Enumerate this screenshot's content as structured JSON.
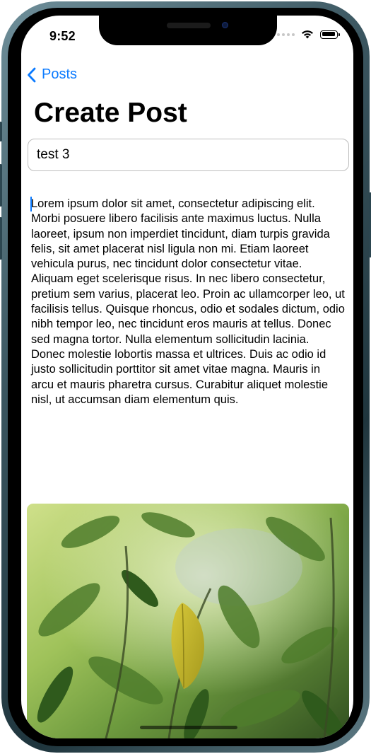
{
  "status_bar": {
    "time": "9:52"
  },
  "nav": {
    "back_label": "Posts",
    "title": "Create Post"
  },
  "form": {
    "title_value": "test 3",
    "body_value": "Lorem ipsum dolor sit amet, consectetur adipiscing elit. Morbi posuere libero facilisis ante maximus luctus. Nulla laoreet, ipsum non imperdiet tincidunt, diam turpis gravida felis, sit amet placerat nisl ligula non mi. Etiam laoreet vehicula purus, nec tincidunt dolor consectetur vitae. Aliquam eget scelerisque risus. In nec libero consectetur, pretium sem varius, placerat leo. Proin ac ullamcorper leo, ut facilisis tellus. Quisque rhoncus, odio et sodales dictum, odio nibh tempor leo, nec tincidunt eros mauris at tellus. Donec sed magna tortor. Nulla elementum sollicitudin lacinia. Donec molestie lobortis massa et ultrices. Duis ac odio id justo sollicitudin porttitor sit amet vitae magna. Mauris in arcu et mauris pharetra cursus. Curabitur aliquet molestie nisl, ut accumsan diam elementum quis."
  },
  "icons": {
    "back": "chevron-left-icon",
    "wifi": "wifi-icon",
    "battery": "battery-icon",
    "cellular": "cellular-dots-icon"
  },
  "colors": {
    "accent": "#0a7aff",
    "frame": "#3b5660"
  }
}
